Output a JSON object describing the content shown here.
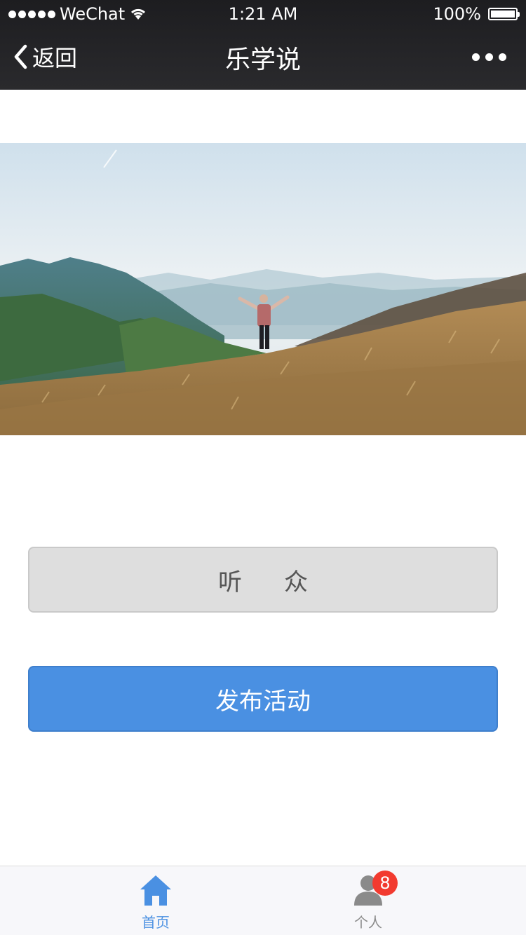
{
  "status_bar": {
    "carrier": "WeChat",
    "time": "1:21 AM",
    "battery": "100%",
    "battery_level": 1.0
  },
  "nav": {
    "back_label": "返回",
    "title": "乐学说",
    "more_icon": "more-dots-icon"
  },
  "banner": {
    "icon": "landscape-photo"
  },
  "buttons": {
    "audience": "听众",
    "publish": "发布活动"
  },
  "tabbar": {
    "home": {
      "label": "首页",
      "icon": "home-icon"
    },
    "personal": {
      "label": "个人",
      "icon": "person-icon",
      "badge": "8"
    }
  },
  "colors": {
    "accent": "#4a90e2",
    "badge": "#f23a2f",
    "header_bg": "#1d1d20"
  }
}
